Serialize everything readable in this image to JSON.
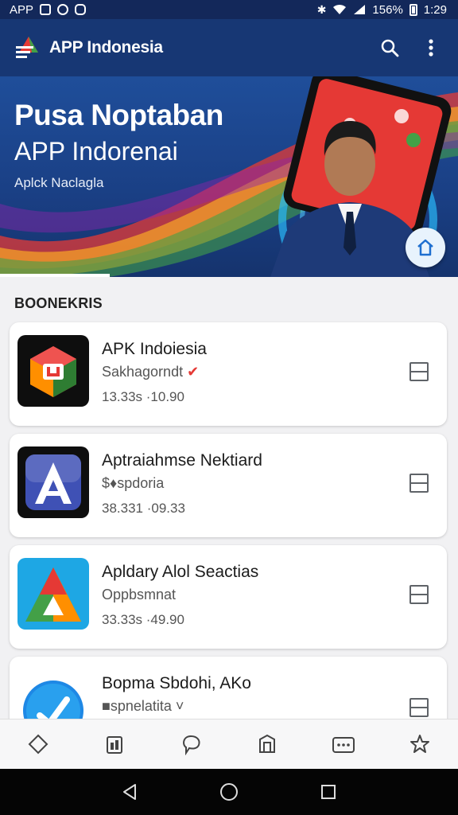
{
  "status_bar": {
    "carrier": "APP",
    "battery": "156%",
    "time": "1:29"
  },
  "app_bar": {
    "title": "APP Indonesia"
  },
  "banner": {
    "title_line1": "Pusa Noptaban",
    "title_line2": "APP Indorenai",
    "subtitle": "Aplck Naclagla"
  },
  "section": {
    "title": "BOONEKRIS"
  },
  "apps": [
    {
      "name": "APK Indoiesia",
      "subtitle": "Sakhagorndt",
      "meta": "13.33s ·10.90",
      "icon": "cube-logo-icon"
    },
    {
      "name": "Aptraiahmse Nektiard",
      "subtitle": "$♦spdoria",
      "meta": "38.331 ·09.33",
      "icon": "letter-a-logo-icon"
    },
    {
      "name": "Apldary Alol Seactias",
      "subtitle": "Oppbsmnat",
      "meta": "33.33s ·49.90",
      "icon": "triangle-logo-icon"
    },
    {
      "name": "Bopma Sbdohi, AKo",
      "subtitle": "■spnelatita ˅",
      "meta": "",
      "icon": "check-circle-logo-icon"
    }
  ],
  "colors": {
    "app_bar": "#173774",
    "status_bar": "#13285a",
    "accent_blue": "#1e88e5"
  }
}
